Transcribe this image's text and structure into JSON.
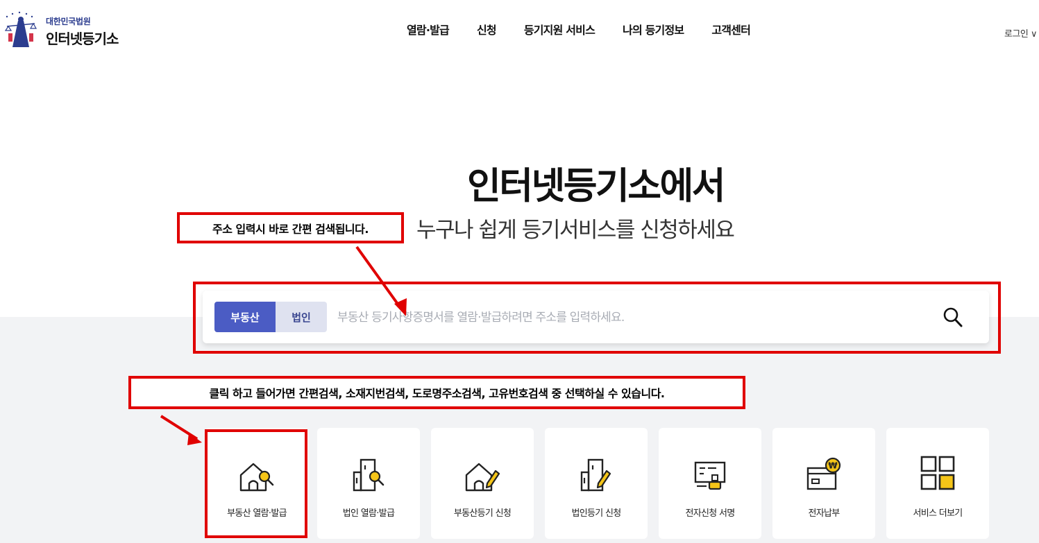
{
  "header": {
    "logo_sub": "대한민국법원",
    "logo_main": "인터넷등기소",
    "nav": [
      "열람·발급",
      "신청",
      "등기지원 서비스",
      "나의 등기정보",
      "고객센터"
    ],
    "login": "로그인 ∨"
  },
  "hero": {
    "title": "인터넷등기소에서",
    "subtitle": "누구나 쉽게 등기서비스를 신청하세요"
  },
  "search": {
    "tabs": [
      "부동산",
      "법인"
    ],
    "active_tab": "부동산",
    "placeholder": "부동산 등기사항증명서를 열람·발급하려면 주소를 입력하세요.",
    "button_icon": "search-icon"
  },
  "cards": [
    {
      "label": "부동산 열람·발급",
      "icon": "house-search-icon"
    },
    {
      "label": "법인 열람·발급",
      "icon": "building-search-icon"
    },
    {
      "label": "부동산등기 신청",
      "icon": "house-pen-icon"
    },
    {
      "label": "법인등기 신청",
      "icon": "building-pen-icon"
    },
    {
      "label": "전자신청 서명",
      "icon": "signature-stamp-icon"
    },
    {
      "label": "전자납부",
      "icon": "payment-won-icon"
    },
    {
      "label": "서비스 더보기",
      "icon": "grid-more-icon"
    }
  ],
  "annotations": {
    "note_search": "주소 입력시 바로 간편 검색됩니다.",
    "note_card": "클릭 하고 들어가면 간편검색, 소재지번검색, 도로명주소검색, 고유번호검색 중 선택하실 수 있습니다."
  },
  "colors": {
    "accent": "#4b5cc4",
    "accent_light": "#dfe2f0",
    "icon_yellow": "#f5c518",
    "annotation_red": "#e00000",
    "band": "#f2f3f5"
  }
}
